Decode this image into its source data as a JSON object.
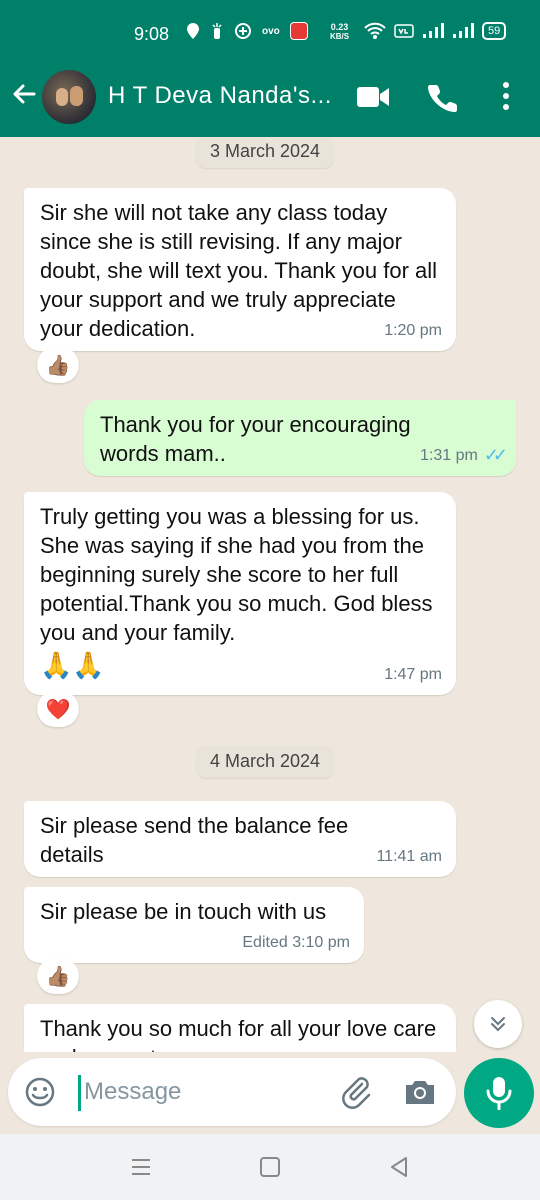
{
  "status_bar": {
    "time": "9:08",
    "net_speed_value": "0.23",
    "net_speed_unit": "KB/S",
    "battery": "59",
    "app_badge": "ovo"
  },
  "header": {
    "contact_name": "H T Deva Nanda's...",
    "back_icon": "arrow-left-icon",
    "video_icon": "video-camera-icon",
    "call_icon": "phone-icon",
    "menu_icon": "more-vertical-icon"
  },
  "chat": {
    "date_1": "3 March 2024",
    "msg_1": {
      "text": "Sir she will not take any class today since she is still revising. If any major doubt, she will text you. Thank you for all your support and we truly appreciate your dedication.",
      "time": "1:20 pm",
      "reaction": "👍🏽"
    },
    "msg_2": {
      "text": "Thank you for your encouraging words mam..",
      "time": "1:31 pm",
      "ticks": "✓✓"
    },
    "msg_3": {
      "text": "Truly getting you was a blessing for us. She was saying if she had you from the beginning surely she score to her full potential.Thank you so much. God bless you and your family.",
      "emoji": "🙏🙏",
      "time": "1:47 pm",
      "reaction": "❤️"
    },
    "date_2": "4 March 2024",
    "msg_4": {
      "text": "Sir please send the balance fee details",
      "time": "11:41 am"
    },
    "msg_5": {
      "text": "Sir please be in touch with us",
      "time": "Edited 3:10 pm",
      "reaction": "👍🏽"
    },
    "msg_6": {
      "text": "Thank you so much for all your love care and support"
    }
  },
  "input": {
    "placeholder": "Message"
  },
  "colors": {
    "primary": "#008069",
    "accent": "#00a884",
    "outgoing_bubble": "#d9fdd3",
    "incoming_bubble": "#ffffff",
    "chat_bg": "#efe7dd",
    "read_tick": "#53bdeb"
  }
}
